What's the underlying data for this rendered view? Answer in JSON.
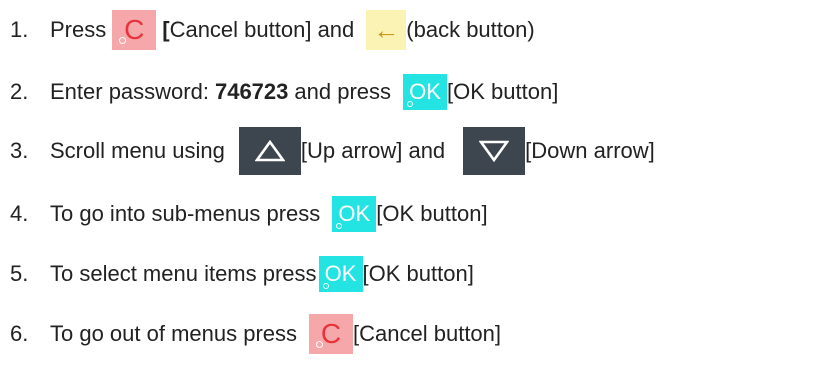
{
  "steps": [
    {
      "number": "1.",
      "parts": {
        "a": "Press",
        "b": "[",
        "c": "Cancel button] and",
        "d": "(back button)"
      }
    },
    {
      "number": "2.",
      "parts": {
        "a": "Enter password:",
        "password": "746723",
        "b": "and press",
        "c": "[OK button]"
      }
    },
    {
      "number": "3.",
      "parts": {
        "a": "Scroll menu using",
        "b": "[Up arrow] and",
        "c": "[Down arrow]"
      }
    },
    {
      "number": "4.",
      "parts": {
        "a": "To go into sub-menus press",
        "b": "[OK button]"
      }
    },
    {
      "number": "5.",
      "parts": {
        "a": "To select menu items press",
        "b": "[OK button]"
      }
    },
    {
      "number": "6.",
      "parts": {
        "a": "To go out of menus press",
        "b": "[Cancel button]"
      }
    }
  ],
  "buttons": {
    "cancel_glyph": "C",
    "back_glyph": "←",
    "ok_glyph": "OK"
  },
  "icons": {
    "cancel": "cancel-c-icon",
    "back": "back-arrow-icon",
    "ok": "ok-icon",
    "up": "up-triangle-icon",
    "down": "down-triangle-icon"
  },
  "colors": {
    "cancel_bg": "#f6a7a9",
    "cancel_fg": "#e8333c",
    "back_bg": "#fbf3b4",
    "ok_bg": "#23e3e3",
    "arrow_bg": "#3d464e"
  }
}
